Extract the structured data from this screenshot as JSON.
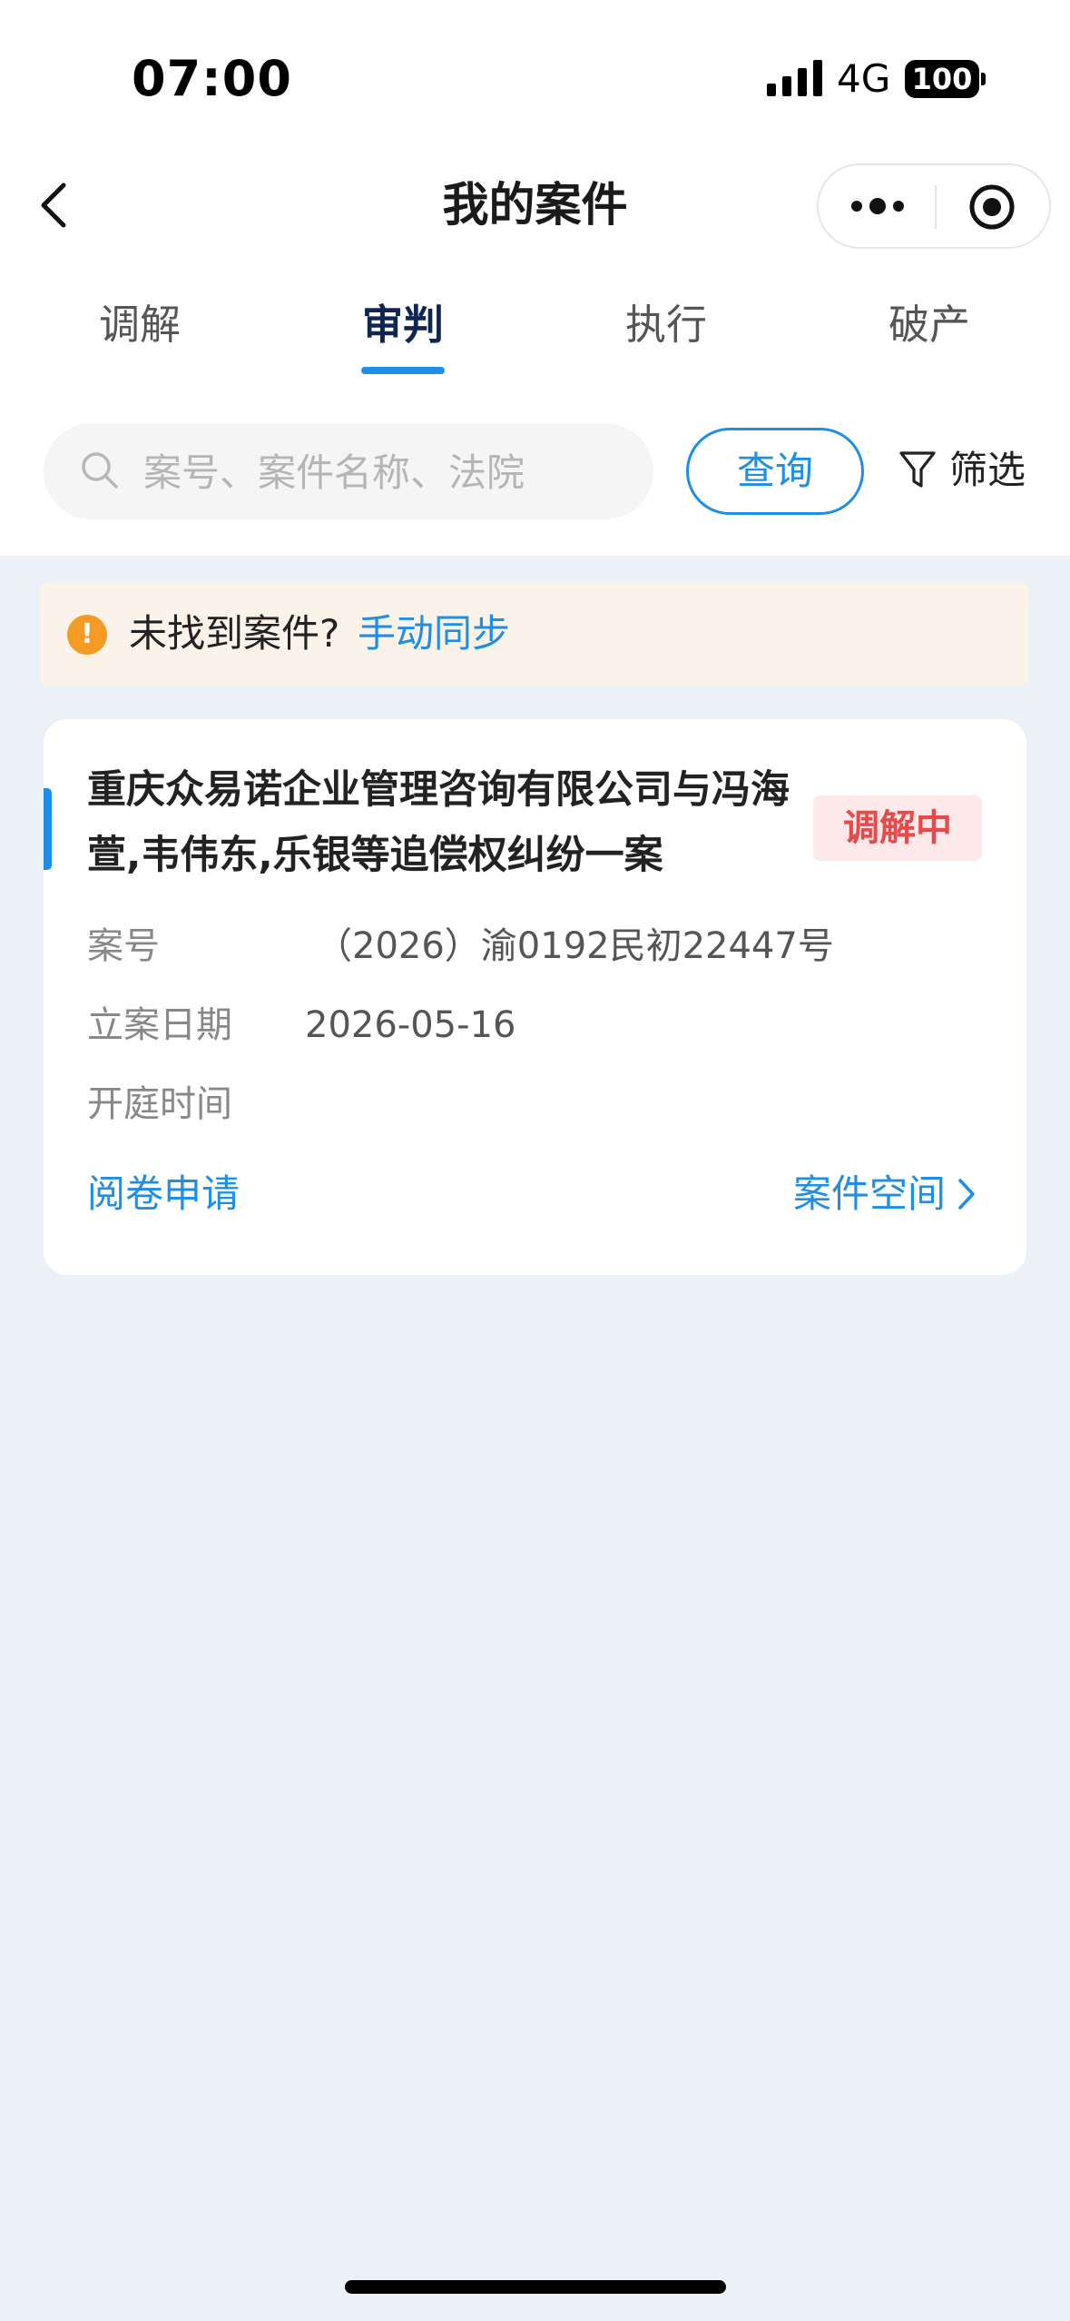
{
  "status_bar": {
    "time": "07:00",
    "network": "4G",
    "battery": "100"
  },
  "nav": {
    "title": "我的案件",
    "back_icon": "chevron-left-icon",
    "more_icon": "more-dots-icon",
    "close_icon": "target-icon"
  },
  "tabs": [
    {
      "label": "调解",
      "active": false
    },
    {
      "label": "审判",
      "active": true
    },
    {
      "label": "执行",
      "active": false
    },
    {
      "label": "破产",
      "active": false
    }
  ],
  "search": {
    "placeholder": "案号、案件名称、法院",
    "value": "",
    "query_label": "查询",
    "filter_label": "筛选"
  },
  "notice": {
    "text": "未找到案件?",
    "link": "手动同步"
  },
  "cases": [
    {
      "title": "重庆众易诺企业管理咨询有限公司与冯海萱,韦伟东,乐银等追偿权纠纷一案",
      "status": "调解中",
      "fields": [
        {
          "label": "案号",
          "value": "（2026）渝0192民初22447号"
        },
        {
          "label": "立案日期",
          "value": "2026-05-16"
        },
        {
          "label": "开庭时间",
          "value": ""
        }
      ],
      "action_left": "阅卷申请",
      "action_right": "案件空间"
    }
  ],
  "colors": {
    "accent": "#1f8ee6",
    "status_red": "#e84a4a",
    "background": "#ecf0f7",
    "notice_bg": "#fbf3ea",
    "warn_orange": "#f59a23"
  }
}
